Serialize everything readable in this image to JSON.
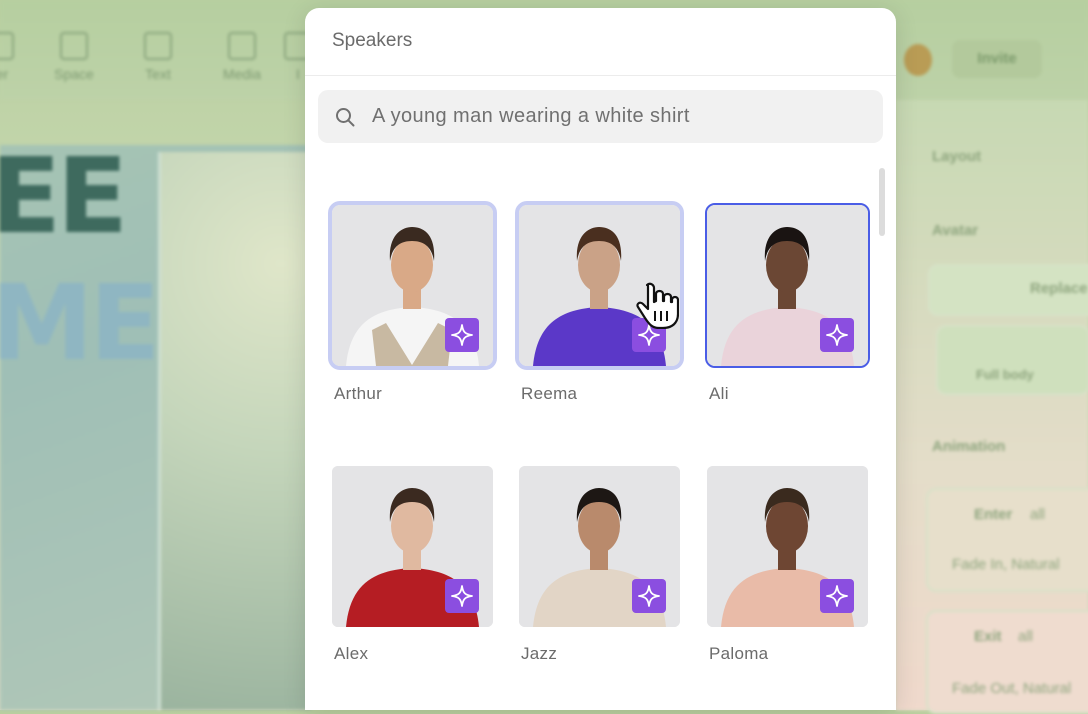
{
  "modal": {
    "title": "Speakers",
    "search": {
      "value": "A young man wearing a white shirt"
    }
  },
  "speakers": [
    {
      "name": "Arthur",
      "state": "hover-selected",
      "shirt": "#f5f5f5",
      "vest": "#c8b9a2",
      "skin": "#d9a987",
      "hair": "#3a2a20"
    },
    {
      "name": "Reema",
      "state": "hover-selected",
      "shirt": "#5b38c8",
      "skin": "#caa287",
      "hair": "#4a2f1f"
    },
    {
      "name": "Ali",
      "state": "active",
      "shirt": "#ead3da",
      "skin": "#6b4734",
      "hair": "#1a1412"
    },
    {
      "name": "Alex",
      "state": "default",
      "shirt": "#b51d23",
      "skin": "#e0b9a0",
      "hair": "#3b2a20"
    },
    {
      "name": "Jazz",
      "state": "default",
      "shirt": "#e2d5c6",
      "skin": "#b98a6c",
      "hair": "#1d1714"
    },
    {
      "name": "Paloma",
      "state": "default",
      "shirt": "#e9bba8",
      "skin": "#6e4633",
      "hair": "#3a2a1e"
    }
  ],
  "background": {
    "toolbar": [
      "ter",
      "Space",
      "Text",
      "Media",
      "I"
    ],
    "invite": "Invite",
    "panel": [
      "Layout",
      "Avatar",
      "Replace",
      "Full body",
      "Animation",
      "Enter",
      "all",
      "Fade In, Natural",
      "Exit",
      "all",
      "Fade Out, Natural"
    ],
    "canvas_text": [
      "EE",
      "ME"
    ]
  },
  "colors": {
    "accent": "#4a5de6",
    "badge": "#8b4ee0"
  }
}
